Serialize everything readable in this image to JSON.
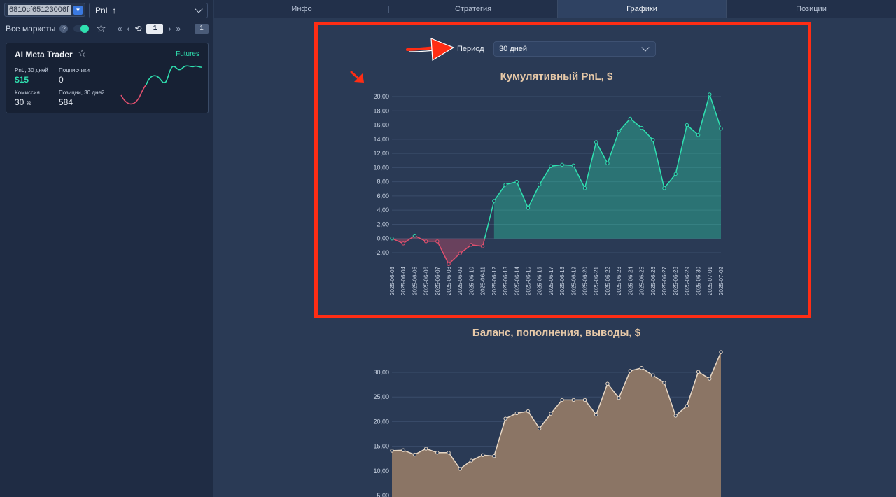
{
  "sidebar": {
    "id_value": "6810cf65123006f",
    "sort_label": "PnL ↑",
    "filter_label": "Все маркеты",
    "help": "?",
    "page": "1",
    "total_pages": "1",
    "card": {
      "title": "AI Meta Trader",
      "badge": "Futures",
      "pnl_label": "PnL, 30 дней",
      "pnl_value": "$15",
      "subs_label": "Подписчики",
      "subs_value": "0",
      "fee_label": "Комиссия",
      "fee_value": "30",
      "fee_unit": "%",
      "positions_label": "Позиции, 30 дней",
      "positions_value": "584"
    }
  },
  "tabs": [
    "Инфо",
    "Стратегия",
    "Графики",
    "Позиции"
  ],
  "active_tab": "Графики",
  "period": {
    "label": "Период",
    "value": "30 дней"
  },
  "colors": {
    "positive": "#2fe0b0",
    "negative": "#e0506e",
    "balance": "#e6d6c4",
    "highlight": "#ff2d14"
  },
  "chart_data": [
    {
      "type": "area",
      "title": "Кумулятивный PnL, $",
      "x": [
        "2025-06-03",
        "2025-06-04",
        "2025-06-05",
        "2025-06-06",
        "2025-06-07",
        "2025-06-08",
        "2025-06-09",
        "2025-06-10",
        "2025-06-11",
        "2025-06-12",
        "2025-06-13",
        "2025-06-14",
        "2025-06-15",
        "2025-06-16",
        "2025-06-17",
        "2025-06-18",
        "2025-06-19",
        "2025-06-20",
        "2025-06-21",
        "2025-06-22",
        "2025-06-23",
        "2025-06-24",
        "2025-06-25",
        "2025-06-26",
        "2025-06-27",
        "2025-06-28",
        "2025-06-29",
        "2025-06-30",
        "2025-07-01",
        "2025-07-02"
      ],
      "values": [
        0.0,
        -0.7,
        0.4,
        -0.4,
        -0.4,
        -3.6,
        -2.1,
        -0.9,
        -1.1,
        5.3,
        7.6,
        8.0,
        4.3,
        7.6,
        10.2,
        10.4,
        10.3,
        7.1,
        13.6,
        10.6,
        15.1,
        16.9,
        15.6,
        13.9,
        7.1,
        9.1,
        16.0,
        14.6,
        20.3,
        15.5
      ],
      "ylim": [
        -2,
        20
      ],
      "yticks": [
        "20,00",
        "18,00",
        "16,00",
        "14,00",
        "12,00",
        "10,00",
        "8,00",
        "6,00",
        "4,00",
        "2,00",
        "0,00",
        "-2,00"
      ],
      "ytick_values": [
        20,
        18,
        16,
        14,
        12,
        10,
        8,
        6,
        4,
        2,
        0,
        -2
      ],
      "grid": true
    },
    {
      "type": "area",
      "title": "Баланс, пополнения, выводы, $",
      "values": [
        14.1,
        14.2,
        13.3,
        14.5,
        13.7,
        13.7,
        10.4,
        12.1,
        13.2,
        13.0,
        20.6,
        21.7,
        22.1,
        18.6,
        21.6,
        24.4,
        24.4,
        24.4,
        21.4,
        27.7,
        24.8,
        30.3,
        30.9,
        29.4,
        27.9,
        21.2,
        23.2,
        30.1,
        28.7,
        34.1
      ],
      "yticks": [
        "30,00",
        "25,00",
        "20,00",
        "15,00",
        "10,00",
        "5,00"
      ],
      "ytick_values": [
        30,
        25,
        20,
        15,
        10,
        5
      ],
      "grid": true
    }
  ]
}
